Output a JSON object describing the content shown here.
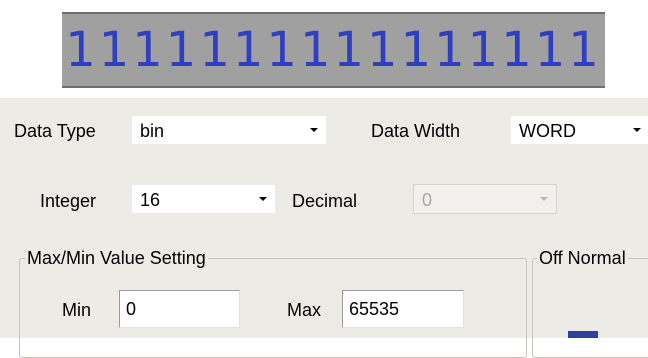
{
  "preview": {
    "value": "1111111111111111",
    "color": "#2f3fbf"
  },
  "data_type": {
    "label": "Data Type",
    "value": "bin"
  },
  "data_width": {
    "label": "Data Width",
    "value": "WORD"
  },
  "integer": {
    "label": "Integer",
    "value": "16"
  },
  "decimal": {
    "label": "Decimal",
    "value": "0"
  },
  "max_min": {
    "title": "Max/Min Value Setting",
    "min_label": "Min",
    "min_value": "0",
    "max_label": "Max",
    "max_value": "65535"
  },
  "off_normal": {
    "title": "Off Normal",
    "swatch_color": "#2e3f9c"
  }
}
